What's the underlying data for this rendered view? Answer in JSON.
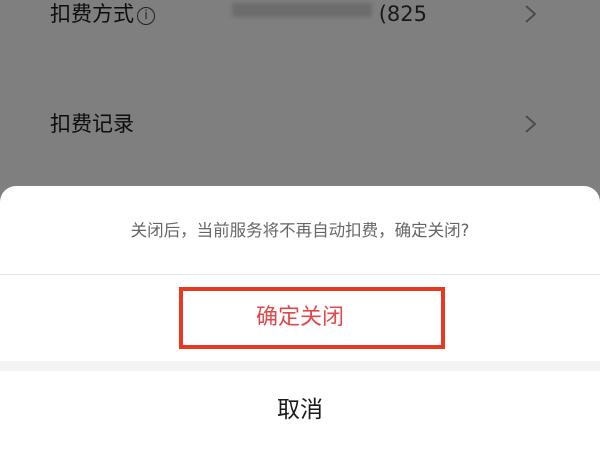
{
  "background": {
    "payment_method": {
      "label": "扣费方式",
      "info_icon_glyph": "i",
      "value_suffix": "(825"
    },
    "deduction_records": {
      "label": "扣费记录"
    }
  },
  "dialog": {
    "message": "关闭后，当前服务将不再自动扣费，确定关闭?",
    "confirm_label": "确定关闭",
    "cancel_label": "取消"
  },
  "colors": {
    "confirm_text": "#e0484a",
    "highlight_border": "#e8381f",
    "overlay": "rgba(0,0,0,0.5)"
  },
  "icons": {
    "info": "info-circle-icon",
    "chevron": "chevron-right-icon"
  }
}
